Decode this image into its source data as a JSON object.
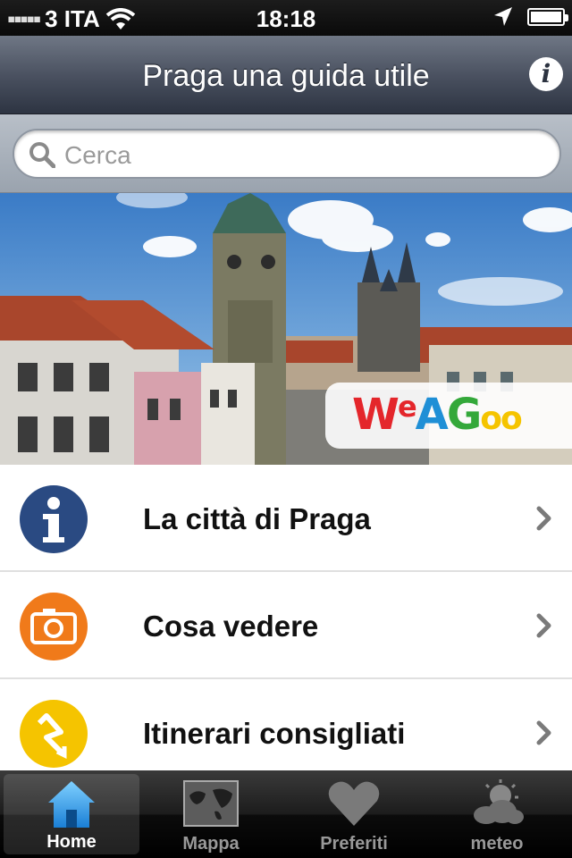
{
  "status": {
    "carrier": "3 ITA",
    "time": "18:18",
    "battery_level": 1.0
  },
  "nav": {
    "title": "Praga una guida utile",
    "info_icon": "info-icon"
  },
  "search": {
    "placeholder": "Cerca"
  },
  "banner": {
    "brand_letters": [
      "W",
      "e",
      "A",
      "G",
      "o",
      "o"
    ],
    "brand_colors": [
      "#e4262b",
      "#e4262b",
      "#1f8fd6",
      "#34a83a",
      "#f5c400",
      "#f5c400"
    ]
  },
  "menu": {
    "items": [
      {
        "label": "La città di Praga",
        "icon": "info-icon",
        "color": "#2a4a82"
      },
      {
        "label": "Cosa vedere",
        "icon": "camera-icon",
        "color": "#f07a1a"
      },
      {
        "label": "Itinerari consigliati",
        "icon": "route-icon",
        "color": "#f5c400"
      }
    ]
  },
  "tabs": {
    "items": [
      {
        "label": "Home",
        "icon": "home-icon",
        "active": true
      },
      {
        "label": "Mappa",
        "icon": "map-icon",
        "active": false
      },
      {
        "label": "Preferiti",
        "icon": "heart-icon",
        "active": false
      },
      {
        "label": "meteo",
        "icon": "weather-icon",
        "active": false
      }
    ]
  }
}
